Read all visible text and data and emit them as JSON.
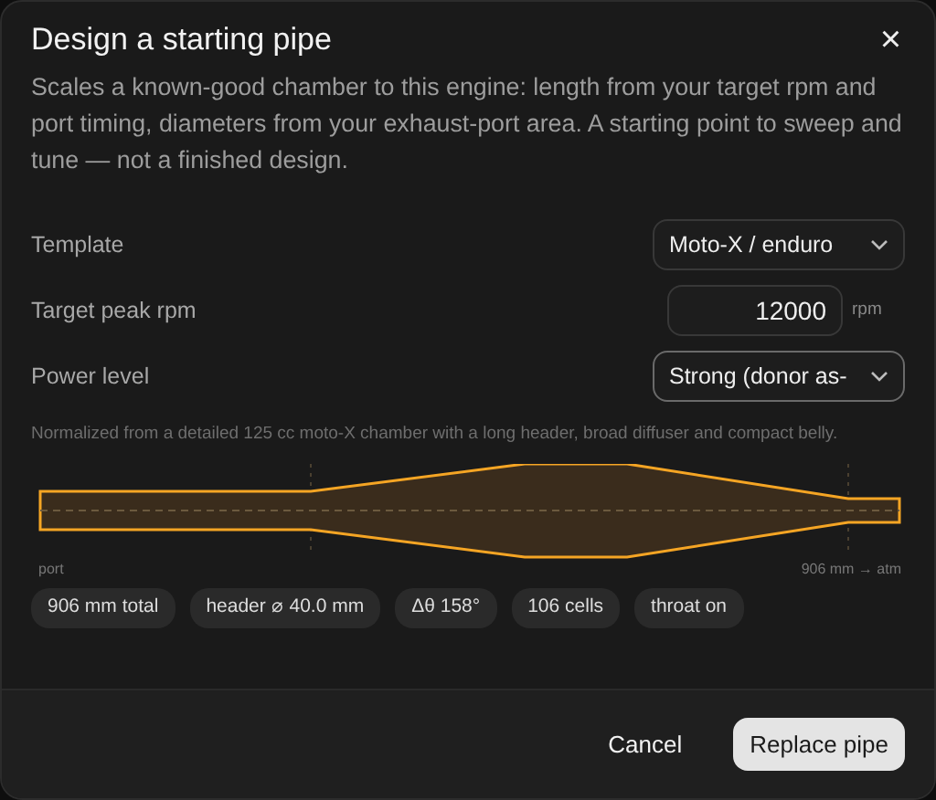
{
  "dialog": {
    "title": "Design a starting pipe",
    "close": "×",
    "description": "Scales a known-good chamber to this engine: length from your target rpm and port timing, diameters from your exhaust-port area. A starting point to sweep and tune — not a finished design."
  },
  "fields": [
    {
      "kind": "select",
      "label": "Template",
      "value": "Moto-X / enduro",
      "focused": false
    },
    {
      "kind": "number",
      "label": "Target peak rpm",
      "value": "12000",
      "unit": "rpm",
      "focused": false
    },
    {
      "kind": "select",
      "label": "Power level",
      "value": "Strong (donor as-",
      "focused": true
    }
  ],
  "note": "Normalized from a detailed 125 cc moto-X chamber with a long header, broad diffuser and compact belly.",
  "preview": {
    "start_label": "port",
    "end_label": "906 mm → atm"
  },
  "chips": [
    "906 mm total",
    "header ⌀ 40.0 mm",
    "Δθ 158°",
    "106 cells",
    "throat on"
  ],
  "buttons": [
    {
      "kind": "secondary",
      "label": "Cancel"
    },
    {
      "kind": "primary",
      "label": "Replace pipe"
    }
  ]
}
